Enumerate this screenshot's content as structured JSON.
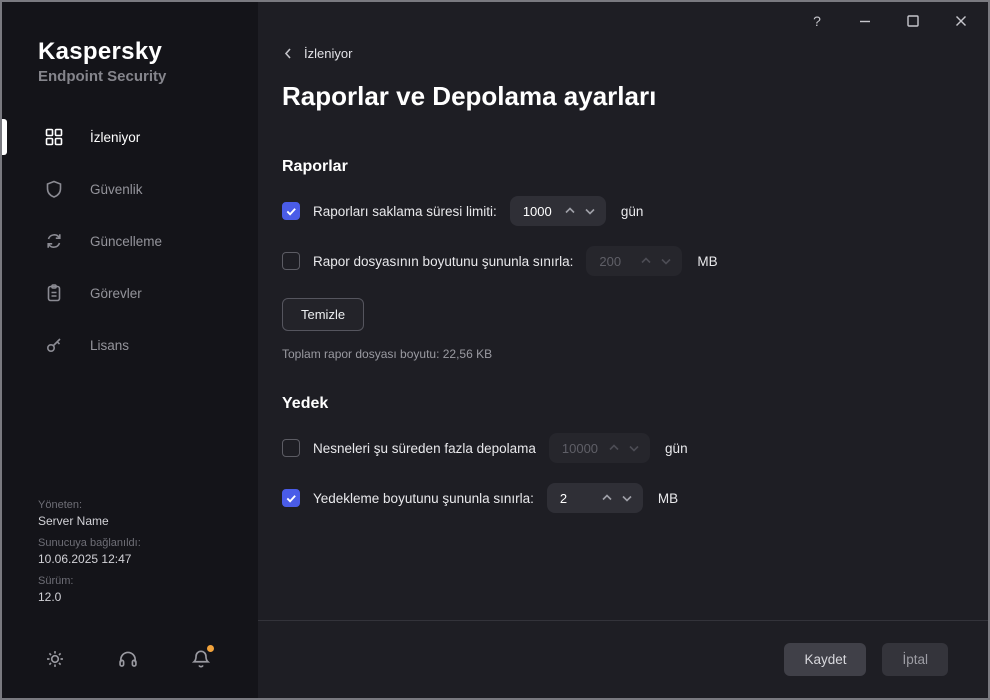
{
  "window": {
    "help": "?"
  },
  "colors": {
    "accent": "#4a5ce8",
    "notification_dot": "#f2a33c"
  },
  "sidebar": {
    "brand_title": "Kaspersky",
    "brand_subtitle": "Endpoint Security",
    "items": [
      {
        "label": "İzleniyor"
      },
      {
        "label": "Güvenlik"
      },
      {
        "label": "Güncelleme"
      },
      {
        "label": "Görevler"
      },
      {
        "label": "Lisans"
      }
    ],
    "info": {
      "managed_label": "Yöneten:",
      "managed_value": "Server Name",
      "connected_label": "Sunucuya bağlanıldı:",
      "connected_value": "10.06.2025 12:47",
      "version_label": "Sürüm:",
      "version_value": "12.0"
    }
  },
  "main": {
    "breadcrumb": "İzleniyor",
    "title": "Raporlar ve Depolama ayarları",
    "reports": {
      "heading": "Raporlar",
      "keep_limit": {
        "label": "Raporları saklama süresi limiti:",
        "value": "1000",
        "unit": "gün",
        "checked": true
      },
      "size_limit": {
        "label": "Rapor dosyasının boyutunu şununla sınırla:",
        "value": "200",
        "unit": "MB",
        "checked": false
      },
      "clear_button": "Temizle",
      "total_size": "Toplam rapor dosyası boyutu: 22,56 KB"
    },
    "backup": {
      "heading": "Yedek",
      "store_limit": {
        "label": "Nesneleri şu süreden fazla depolama",
        "value": "10000",
        "unit": "gün",
        "checked": false
      },
      "size_limit": {
        "label": "Yedekleme boyutunu şununla sınırla:",
        "value": "2",
        "unit": "MB",
        "checked": true
      }
    },
    "footer": {
      "save": "Kaydet",
      "cancel": "İptal"
    }
  }
}
